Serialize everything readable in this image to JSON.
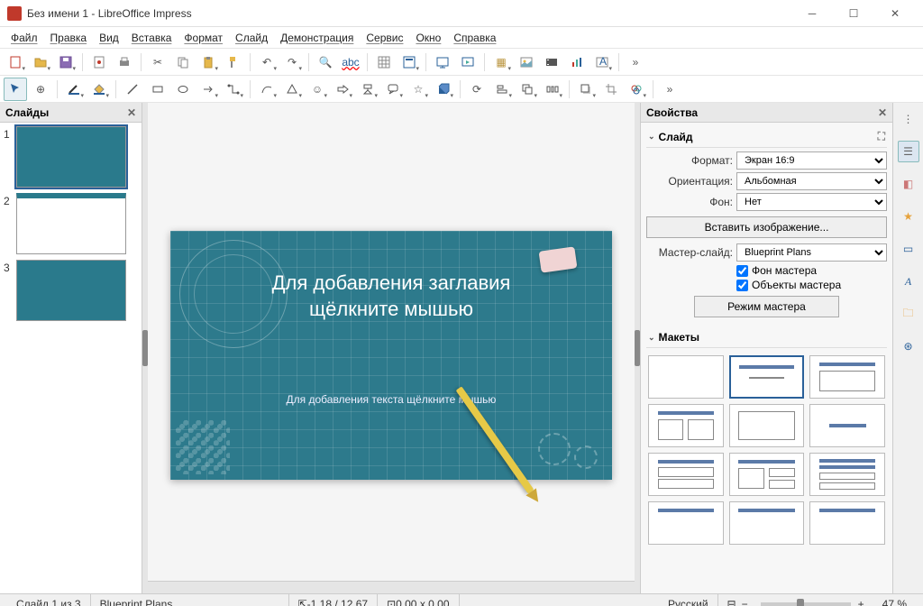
{
  "window": {
    "title": "Без имени 1 - LibreOffice Impress"
  },
  "menu": [
    "Файл",
    "Правка",
    "Вид",
    "Вставка",
    "Формат",
    "Слайд",
    "Демонстрация",
    "Сервис",
    "Окно",
    "Справка"
  ],
  "panels": {
    "slides": {
      "title": "Слайды"
    },
    "properties": {
      "title": "Свойства"
    }
  },
  "props": {
    "section_slide": "Слайд",
    "format_label": "Формат:",
    "format_value": "Экран 16:9",
    "orientation_label": "Ориентация:",
    "orientation_value": "Альбомная",
    "background_label": "Фон:",
    "background_value": "Нет",
    "insert_image_btn": "Вставить изображение...",
    "master_label": "Мастер-слайд:",
    "master_value": "Blueprint Plans",
    "master_bg_check": "Фон мастера",
    "master_obj_check": "Объекты мастера",
    "master_mode_btn": "Режим мастера",
    "section_layouts": "Макеты"
  },
  "slide_content": {
    "title_placeholder": "Для добавления заглавия\nщёлкните мышью",
    "text_placeholder": "Для добавления текста щёлкните мышью"
  },
  "slides": [
    {
      "num": "1",
      "kind": "blueprint",
      "active": true
    },
    {
      "num": "2",
      "kind": "white"
    },
    {
      "num": "3",
      "kind": "blueprint"
    }
  ],
  "status": {
    "slide_count": "Слайд 1 из 3",
    "master": "Blueprint Plans",
    "coords": "-1,18 / 12,67",
    "size": "0,00 x 0,00",
    "lang": "Русский",
    "zoom": "47 %"
  }
}
